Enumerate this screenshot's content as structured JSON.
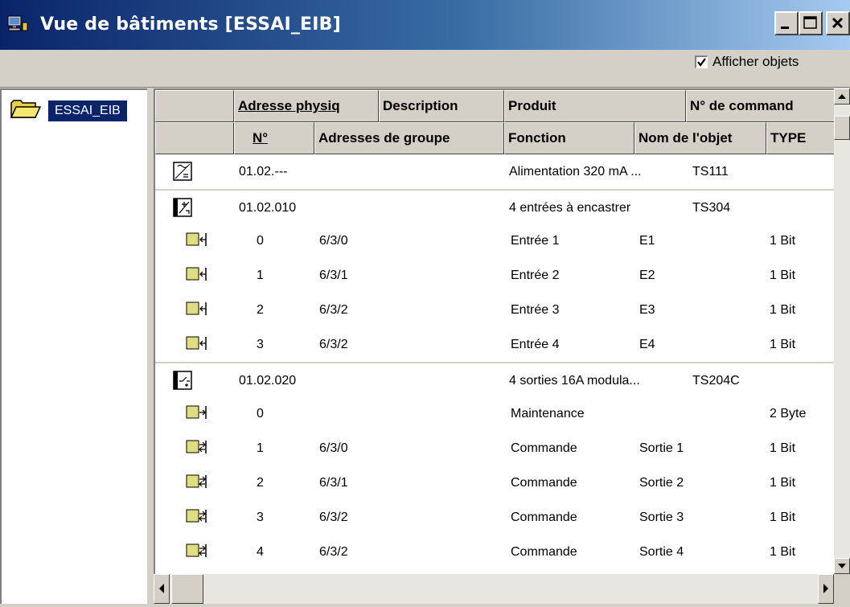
{
  "window": {
    "title": "Vue de bâtiments [ESSAI_EIB]",
    "icon": "building-view-icon",
    "buttons": [
      "minimize",
      "maximize",
      "close"
    ]
  },
  "toolbar": {
    "show_objects_label": "Afficher objets",
    "show_objects_checked": true
  },
  "tree": {
    "root_label": "ESSAI_EIB",
    "root_icon": "open-folder-icon"
  },
  "columns": {
    "row1": [
      "Adresse physiq",
      "Description",
      "Produit",
      "N° de command"
    ],
    "row2": [
      "N°",
      "Adresses de groupe",
      "Fonction",
      "Nom de l'objet",
      "TYPE"
    ]
  },
  "rows": [
    {
      "kind": "device",
      "icon": "power-supply-icon",
      "address": "01.02.---",
      "product": "Alimentation 320 mA ...",
      "order": "TS111"
    },
    {
      "kind": "device",
      "icon": "input-module-icon",
      "address": "01.02.010",
      "product": "4 entrées à encastrer",
      "order": "TS304"
    },
    {
      "kind": "object",
      "icon": "input-object-icon",
      "num": "0",
      "group": "6/3/0",
      "function": "Entrée 1",
      "name": "E1",
      "type": "1 Bit"
    },
    {
      "kind": "object",
      "icon": "input-object-icon",
      "num": "1",
      "group": "6/3/1",
      "function": "Entrée 2",
      "name": "E2",
      "type": "1 Bit"
    },
    {
      "kind": "object",
      "icon": "input-object-icon",
      "num": "2",
      "group": "6/3/2",
      "function": "Entrée 3",
      "name": "E3",
      "type": "1 Bit"
    },
    {
      "kind": "object",
      "icon": "input-object-icon",
      "num": "3",
      "group": "6/3/2",
      "function": "Entrée 4",
      "name": "E4",
      "type": "1 Bit"
    },
    {
      "kind": "device",
      "icon": "output-module-icon",
      "address": "01.02.020",
      "product": "4 sorties 16A modula...",
      "order": "TS204C"
    },
    {
      "kind": "object",
      "icon": "output-object-icon",
      "num": "0",
      "group": "",
      "function": "Maintenance",
      "name": "",
      "type": "2 Byte"
    },
    {
      "kind": "object",
      "icon": "bidirectional-object-icon",
      "num": "1",
      "group": "6/3/0",
      "function": "Commande",
      "name": "Sortie 1",
      "type": "1 Bit"
    },
    {
      "kind": "object",
      "icon": "bidirectional-object-icon",
      "num": "2",
      "group": "6/3/1",
      "function": "Commande",
      "name": "Sortie 2",
      "type": "1 Bit"
    },
    {
      "kind": "object",
      "icon": "bidirectional-object-icon",
      "num": "3",
      "group": "6/3/2",
      "function": "Commande",
      "name": "Sortie 3",
      "type": "1 Bit"
    },
    {
      "kind": "object",
      "icon": "bidirectional-object-icon",
      "num": "4",
      "group": "6/3/2",
      "function": "Commande",
      "name": "Sortie 4",
      "type": "1 Bit"
    }
  ],
  "colors": {
    "title_start": "#0a246a",
    "title_end": "#a6caf0",
    "face": "#d4d0c8",
    "object_icon": "#e0dc80"
  }
}
